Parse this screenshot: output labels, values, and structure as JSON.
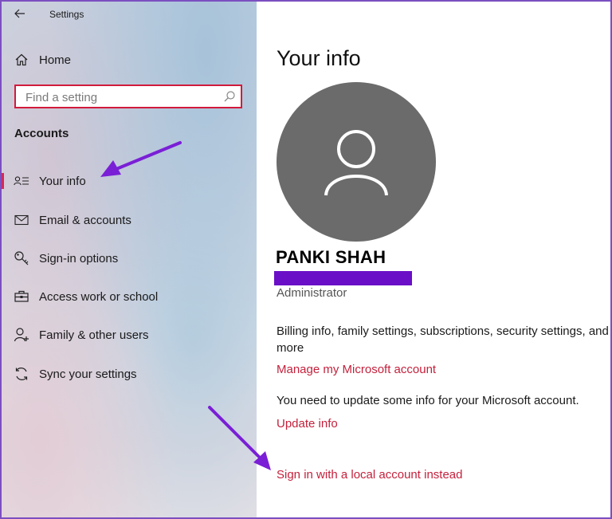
{
  "window": {
    "title": "Settings"
  },
  "sidebar": {
    "home_label": "Home",
    "search": {
      "placeholder": "Find a setting"
    },
    "section_heading": "Accounts",
    "items": [
      {
        "label": "Your info",
        "icon": "person-card-icon",
        "selected": true
      },
      {
        "label": "Email & accounts",
        "icon": "mail-icon",
        "selected": false
      },
      {
        "label": "Sign-in options",
        "icon": "key-icon",
        "selected": false
      },
      {
        "label": "Access work or school",
        "icon": "briefcase-icon",
        "selected": false
      },
      {
        "label": "Family & other users",
        "icon": "person-add-icon",
        "selected": false
      },
      {
        "label": "Sync your settings",
        "icon": "sync-icon",
        "selected": false
      }
    ]
  },
  "main": {
    "title": "Your info",
    "user_name": "PANKI SHAH",
    "role": "Administrator",
    "billing_description": "Billing info, family settings, subscriptions, security settings, and more",
    "manage_link": "Manage my Microsoft account",
    "update_notice": "You need to update some info for your Microsoft account.",
    "update_link": "Update info",
    "local_account_link": "Sign in with a local account instead"
  },
  "colors": {
    "accent_link": "#c4213c",
    "selection_bar": "#d42a5a",
    "search_border": "#d11a3c",
    "avatar_bg": "#6b6b6b",
    "annotation_arrow": "#7a1fd6",
    "redaction": "#6a0fc7",
    "frame_border": "#7b4fc0"
  }
}
